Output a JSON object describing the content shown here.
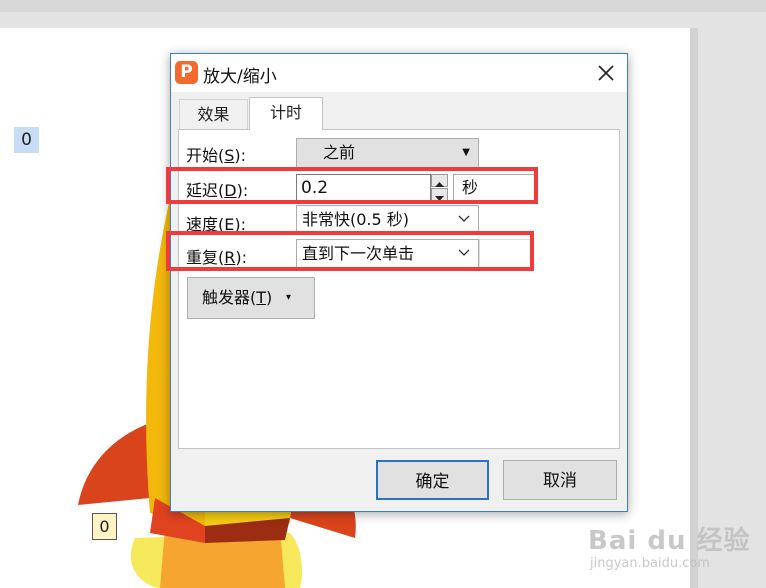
{
  "dialog": {
    "title": "放大/缩小",
    "app_logo": "P",
    "tabs": [
      {
        "label": "效果"
      },
      {
        "label": "计时"
      }
    ],
    "fields": {
      "start": {
        "label": "开始",
        "key": "S",
        "value": "之前"
      },
      "delay": {
        "label": "延迟",
        "key": "D",
        "value": "0.2",
        "unit": "秒"
      },
      "speed": {
        "label": "速度",
        "key": "E",
        "value": "非常快(0.5 秒)"
      },
      "repeat": {
        "label": "重复",
        "key": "R",
        "value": "直到下一次单击"
      }
    },
    "trigger": {
      "label": "触发器",
      "key": "T"
    },
    "buttons": {
      "ok": "确定",
      "cancel": "取消"
    }
  },
  "slide": {
    "animation_tags": [
      "0",
      "0"
    ]
  },
  "watermark": {
    "main": "Bai du 经验",
    "sub": "jingyan.baidu.com"
  },
  "icons": {
    "close": "close-icon",
    "spin": "spin-arrows-icon",
    "dropdown": "chevron-down-icon"
  },
  "colors": {
    "highlight": "#ef3b3b",
    "accent": "#2a73c4",
    "logo": "#f46a2e"
  }
}
